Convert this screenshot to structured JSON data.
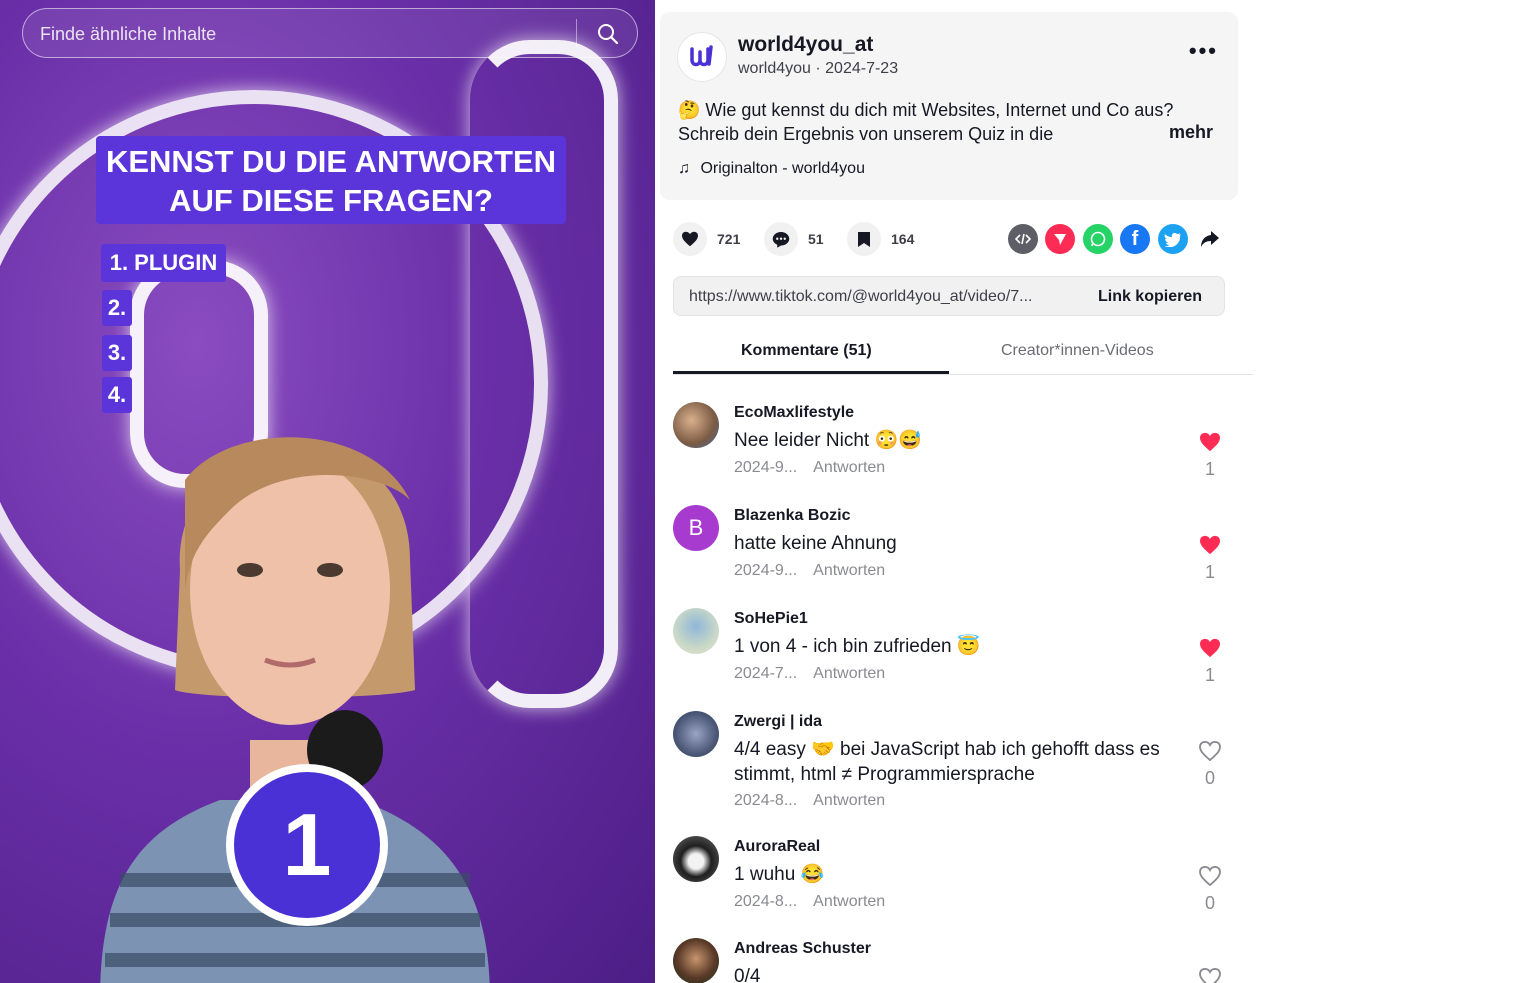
{
  "video": {
    "search_placeholder": "Finde ähnliche Inhalte",
    "headline_line1": "KENNST DU DIE ANTWORTEN",
    "headline_line2": "AUF DIESE FRAGEN?",
    "list": [
      "1. PLUGIN",
      "2.",
      "3.",
      "4."
    ],
    "badge_number": "1",
    "colors": {
      "background": "#6a2fa8",
      "accent": "#5b35d9"
    }
  },
  "post": {
    "username": "world4you_at",
    "subline": "world4you · 2024-7-23",
    "description_line1": "🤔 Wie gut kennst du dich mit Websites, Internet und Co aus?",
    "description_line2": "Schreib dein Ergebnis von unserem Quiz in die",
    "more": "mehr",
    "music": "Originalton - world4you"
  },
  "actions": {
    "likes": "721",
    "comments": "51",
    "saves": "164",
    "share_icons": [
      "embed-icon",
      "send-icon",
      "whatsapp-icon",
      "facebook-icon",
      "twitter-icon",
      "share-arrow-icon"
    ]
  },
  "link": {
    "url": "https://www.tiktok.com/@world4you_at/video/7...",
    "copy_label": "Link kopieren"
  },
  "tabs": {
    "comments": "Kommentare (51)",
    "creator_videos": "Creator*innen-Videos"
  },
  "comments": [
    {
      "name": "EcoMaxlifestyle",
      "text": "Nee leider Nicht 😳😅",
      "date": "2024-9...",
      "reply": "Antworten",
      "likes": "1",
      "liked": true
    },
    {
      "name": "Blazenka Bozic",
      "text": "hatte keine Ahnung",
      "date": "2024-9...",
      "reply": "Antworten",
      "likes": "1",
      "liked": true,
      "initial": "B"
    },
    {
      "name": "SoHePie1",
      "text": "1 von 4 - ich bin zufrieden 😇",
      "date": "2024-7...",
      "reply": "Antworten",
      "likes": "1",
      "liked": true
    },
    {
      "name": "Zwergi | ida",
      "text": "4/4 easy 🤝 bei JavaScript hab ich gehofft dass es stimmt, html ≠ Programmiersprache",
      "date": "2024-8...",
      "reply": "Antworten",
      "likes": "0",
      "liked": false
    },
    {
      "name": "AuroraReal",
      "text": "1 wuhu 😂",
      "date": "2024-8...",
      "reply": "Antworten",
      "likes": "0",
      "liked": false
    },
    {
      "name": "Andreas Schuster",
      "text": "0/4",
      "date": "",
      "reply": "",
      "likes": "",
      "liked": false
    }
  ]
}
